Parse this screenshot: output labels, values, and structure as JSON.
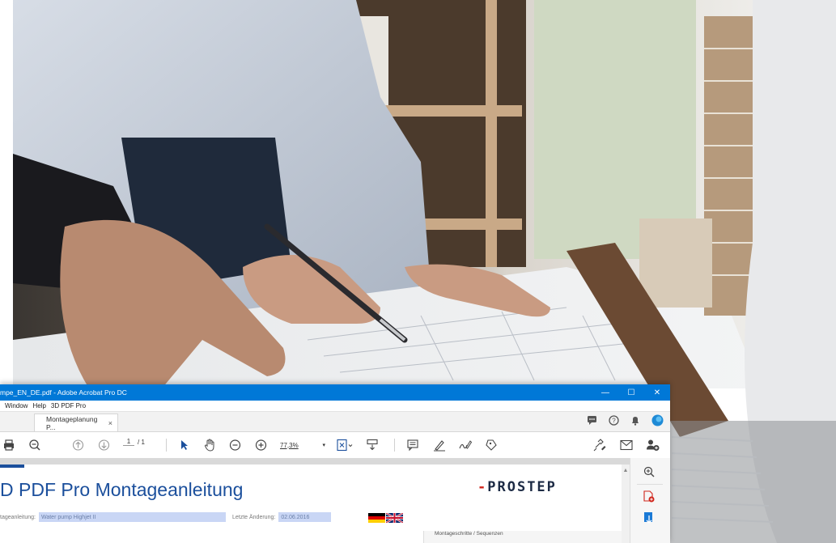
{
  "window": {
    "title": "mpe_EN_DE.pdf - Adobe Acrobat Pro DC",
    "controls": {
      "minimize": "—",
      "maximize": "☐",
      "close": "✕"
    }
  },
  "menu": [
    "Window",
    "Help",
    "3D PDF Pro"
  ],
  "tab": {
    "label": "Montageplanung P...",
    "close": "×"
  },
  "toolbar": {
    "page_current": "1",
    "page_total": "/ 1",
    "zoom": "77,3%"
  },
  "document": {
    "title": "D PDF Pro  Montageanleitung",
    "logo_dash": "-",
    "logo_text": "PROSTEP",
    "field1_label": "tageanleitung:",
    "field1_value": "Water pump Highjet II",
    "field2_label": "Letzte Änderung:",
    "field2_value": "02.06.2016",
    "steps_label": "Montageschritte / Sequenzen"
  },
  "colors": {
    "titlebar": "#0078d7",
    "accent": "#1b4f9c",
    "field_bg": "#c9d6f5",
    "logo_red": "#d0251b"
  },
  "icons": {
    "print": "print-icon",
    "zoom_out": "zoom-out-icon",
    "prev_page": "arrow-up-circle-icon",
    "next_page": "arrow-down-circle-icon",
    "select": "cursor-icon",
    "hand": "hand-icon",
    "minus": "minus-circle-icon",
    "plus": "plus-circle-icon"
  }
}
